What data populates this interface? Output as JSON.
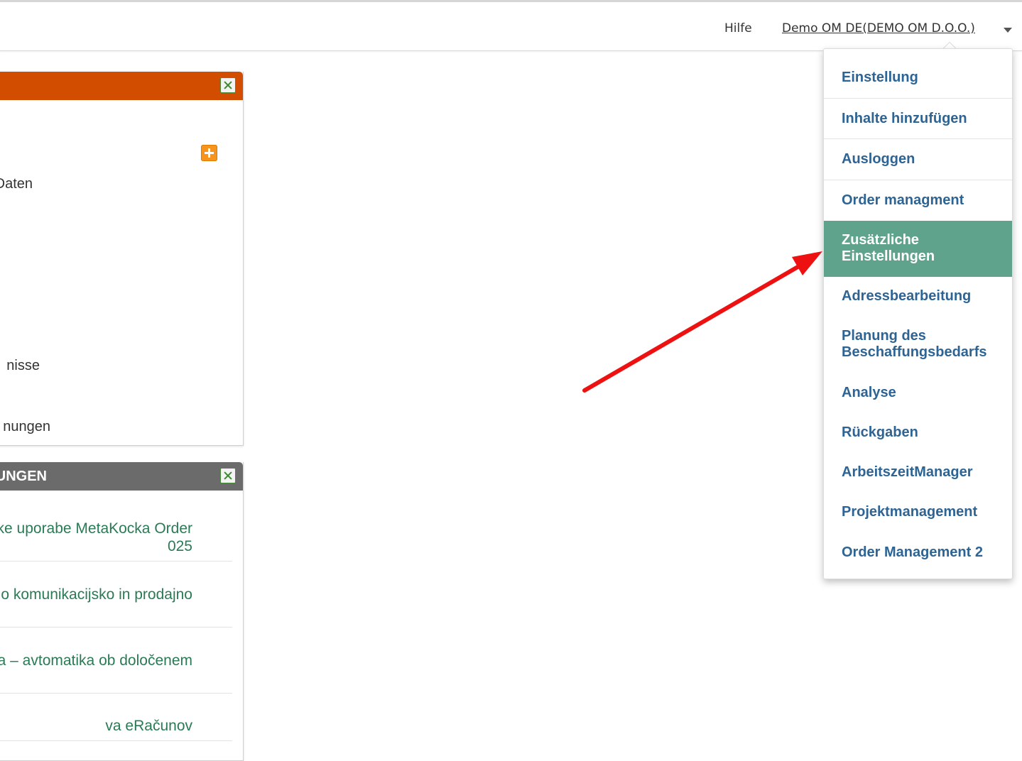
{
  "header": {
    "help_label": "Hilfe",
    "user_label": "Demo OM DE(DEMO OM D.O.O.)"
  },
  "widget_top": {
    "title": "",
    "items": [
      "Daten",
      "nisse",
      "nungen"
    ]
  },
  "widget_news": {
    "title": "UNGEN",
    "items": [
      "ke uporabe MetaKocka Order\n025",
      "o komunikacijsko in prodajno",
      "a – avtomatika ob določenem",
      "va eRačunov"
    ]
  },
  "dropdown": {
    "items": [
      "Einstellung",
      "Inhalte hinzufügen",
      "Ausloggen",
      "Order managment",
      "Zusätzliche Einstellungen",
      "Adressbearbeitung",
      "Planung des Beschaffungsbedarfs",
      "Analyse",
      "Rückgaben",
      "ArbeitszeitManager",
      "Projektmanagement",
      "Order Management 2"
    ],
    "active_item": "Zusätzliche Einstellungen"
  },
  "colors": {
    "orange_header": "#d24d00",
    "gray_header": "#6b6b6b",
    "menu_text": "#2e6494",
    "menu_active_bg": "#5fa38c",
    "news_link": "#2a7a55",
    "annotation_arrow": "#ee1111"
  }
}
